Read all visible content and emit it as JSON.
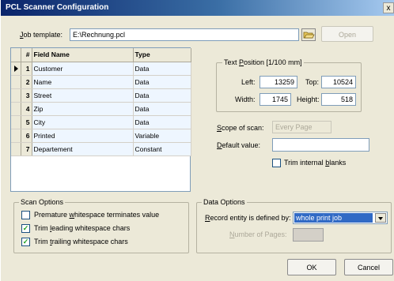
{
  "window": {
    "title": "PCL Scanner Configuration",
    "close_glyph": "x"
  },
  "job_template": {
    "label_pre": "",
    "label_u": "J",
    "label_post": "ob template:",
    "value": "E:\\Rechnung.pcl",
    "open_label": "Open",
    "browse_icon": "folder-icon"
  },
  "grid": {
    "headers": {
      "num": "#",
      "name": "Field Name",
      "type": "Type"
    },
    "rows": [
      {
        "num": "1",
        "name": "Customer",
        "type": "Data"
      },
      {
        "num": "2",
        "name": "Name",
        "type": "Data"
      },
      {
        "num": "3",
        "name": "Street",
        "type": "Data"
      },
      {
        "num": "4",
        "name": "Zip",
        "type": "Data"
      },
      {
        "num": "5",
        "name": "City",
        "type": "Data"
      },
      {
        "num": "6",
        "name": "Printed",
        "type": "Variable"
      },
      {
        "num": "7",
        "name": "Departement",
        "type": "Constant"
      }
    ]
  },
  "text_position": {
    "title_pre": "Text ",
    "title_u": "P",
    "title_post": "osition [1/100 mm]",
    "left_label": "Left:",
    "left_value": "13259",
    "top_label": "Top:",
    "top_value": "10524",
    "width_label": "Width:",
    "width_value": "1745",
    "height_label": "Height:",
    "height_value": "518"
  },
  "scope": {
    "label_pre": "",
    "label_u": "S",
    "label_post": "cope of scan:",
    "value": "Every Page"
  },
  "default_value": {
    "label_pre": "",
    "label_u": "D",
    "label_post": "efault value:",
    "value": ""
  },
  "trim_blanks": {
    "label_pre": "Trim internal ",
    "label_u": "b",
    "label_post": "lanks",
    "checked": false
  },
  "scan_options": {
    "title": "Scan Options",
    "items": [
      {
        "pre": "Premature ",
        "u": "w",
        "post": "hitespace terminates value",
        "checked": false,
        "mark": ""
      },
      {
        "pre": "Trim ",
        "u": "l",
        "post": "eading whitespace chars",
        "checked": true,
        "mark": "✓"
      },
      {
        "pre": "Trim ",
        "u": "t",
        "post": "railing whitespace chars",
        "checked": true,
        "mark": "✓"
      }
    ]
  },
  "data_options": {
    "title": "Data Options",
    "record_label_pre": "",
    "record_label_u": "R",
    "record_label_post": "ecord entity is defined by:",
    "record_value": "whole print job",
    "pages_label_pre": "",
    "pages_label_u": "N",
    "pages_label_post": "umber of Pages:",
    "pages_value": ""
  },
  "buttons": {
    "ok": "OK",
    "cancel": "Cancel"
  },
  "colors": {
    "title_bar": "#0a246a",
    "selection": "#316ac5",
    "dialog_bg": "#ece9d8"
  }
}
